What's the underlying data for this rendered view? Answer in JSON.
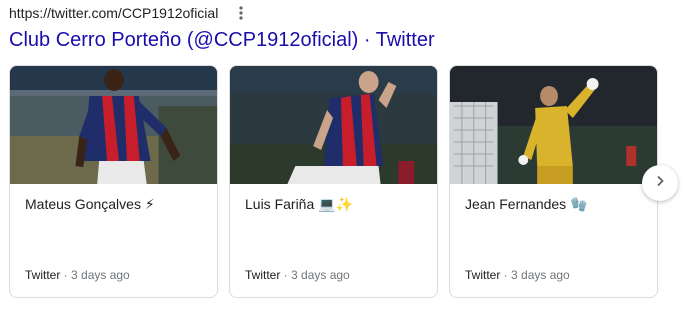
{
  "result": {
    "url": "https://twitter.com/CCP1912oficial",
    "title": "Club Cerro Porteño (@CCP1912oficial) · Twitter",
    "menu_icon": "more-vert-icon"
  },
  "cards": [
    {
      "name": "Mateus Gonçalves ⚡",
      "source": "Twitter",
      "separator": " · ",
      "age": "3 days ago"
    },
    {
      "name": "Luis Fariña 💻✨",
      "source": "Twitter",
      "separator": " · ",
      "age": "3 days ago"
    },
    {
      "name": "Jean Fernandes 🧤",
      "source": "Twitter",
      "separator": " · ",
      "age": "3 days ago"
    }
  ],
  "carousel": {
    "next_icon": "chevron-right-icon"
  },
  "colors": {
    "link": "#1a0dab",
    "text": "#202124",
    "muted": "#70757a",
    "border": "#dadce0"
  }
}
